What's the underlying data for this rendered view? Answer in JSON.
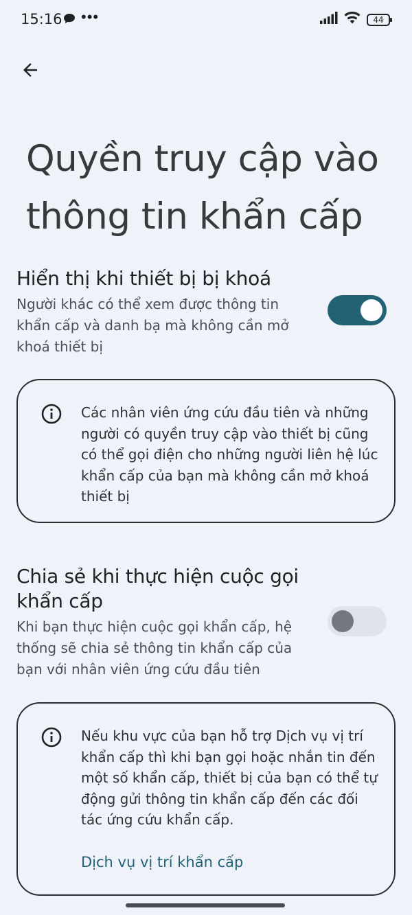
{
  "status_bar": {
    "time": "15:16",
    "more_dots": "•••",
    "battery": "44",
    "icons": [
      "chat-bubble-icon",
      "signal-icon",
      "wifi-icon",
      "battery-icon"
    ]
  },
  "header": {
    "title": "Quyền truy cập vào thông tin khẩn cấp"
  },
  "lock_screen_section": {
    "title": "Hiển thị khi thiết bị bị khoá",
    "description": "Người khác có thể xem được thông tin khẩn cấp và danh bạ mà không cần mở khoá thiết bị",
    "enabled": true
  },
  "lock_screen_info": {
    "text": "Các nhân viên ứng cứu đầu tiên và những người có quyền truy cập vào thiết bị cũng có thể gọi điện cho những người liên hệ lúc khẩn cấp của bạn mà không cần mở khoá thiết bị"
  },
  "share_section": {
    "title": "Chia sẻ khi thực hiện cuộc gọi khẩn cấp",
    "description": "Khi bạn thực hiện cuộc gọi khẩn cấp, hệ thống sẽ chia sẻ thông tin khẩn cấp của bạn với nhân viên ứng cứu đầu tiên",
    "enabled": false
  },
  "share_info": {
    "text": "Nếu khu vực của bạn hỗ trợ Dịch vụ vị trí khẩn cấp thì khi bạn gọi hoặc nhắn tin đến một số khẩn cấp, thiết bị của bạn có thể tự động gửi thông tin khẩn cấp đến các đối tác ứng cứu khẩn cấp.",
    "link": "Dịch vụ vị trí khẩn cấp"
  },
  "colors": {
    "background": "#eff2f8",
    "accent": "#236275",
    "toggle_off_track": "#e0e3e9"
  }
}
